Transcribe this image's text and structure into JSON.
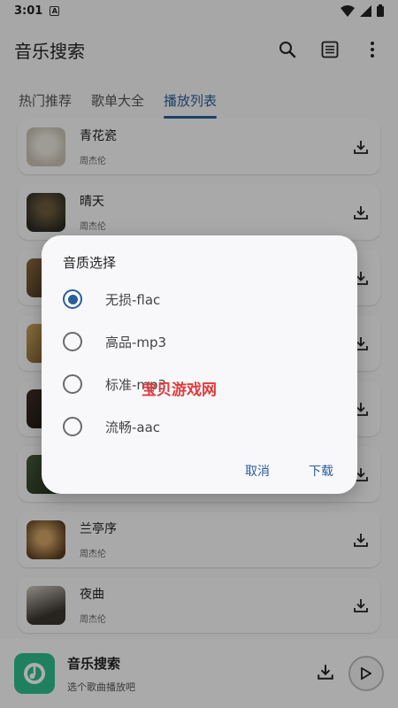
{
  "status": {
    "time": "3:01",
    "notif_letter": "A"
  },
  "appbar": {
    "title": "音乐搜索",
    "icons": [
      "search-icon",
      "list-icon",
      "more-icon"
    ]
  },
  "tabs": [
    {
      "label": "热门推荐",
      "active": false
    },
    {
      "label": "歌单大全",
      "active": false
    },
    {
      "label": "播放列表",
      "active": true
    }
  ],
  "songs": [
    {
      "title": "青花瓷",
      "artist": "周杰伦"
    },
    {
      "title": "晴天",
      "artist": "周杰伦"
    },
    {
      "title": "",
      "artist": ""
    },
    {
      "title": "",
      "artist": ""
    },
    {
      "title": "",
      "artist": ""
    },
    {
      "title": "",
      "artist": ""
    },
    {
      "title": "兰亭序",
      "artist": "周杰伦"
    },
    {
      "title": "夜曲",
      "artist": "周杰伦"
    }
  ],
  "dialog": {
    "title": "音质选择",
    "options": [
      {
        "label": "无损-flac",
        "selected": true
      },
      {
        "label": "高品-mp3",
        "selected": false
      },
      {
        "label": "标准-mp3",
        "selected": false
      },
      {
        "label": "流畅-aac",
        "selected": false
      }
    ],
    "cancel": "取消",
    "download": "下载"
  },
  "watermark": "宝贝游戏网",
  "player": {
    "title": "音乐搜索",
    "subtitle": "选个歌曲播放吧"
  },
  "colors": {
    "accent": "#2b5d9c",
    "logo": "#2ebd8d",
    "watermark": "#e23b3b"
  }
}
